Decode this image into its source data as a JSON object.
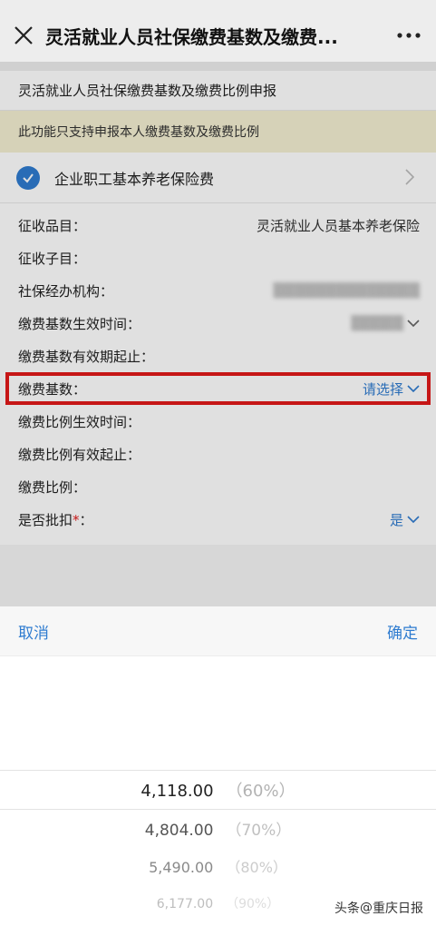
{
  "window": {
    "title": "灵活就业人员社保缴费基数及缴费..."
  },
  "page": {
    "header": "灵活就业人员社保缴费基数及缴费比例申报",
    "notice": "此功能只支持申报本人缴费基数及缴费比例",
    "insurance_item": "企业职工基本养老保险费",
    "fields": [
      {
        "label": "征收品目：",
        "value": "灵活就业人员基本养老保险"
      },
      {
        "label": "征收子目：",
        "value": ""
      },
      {
        "label": "社保经办机构：",
        "value": ""
      },
      {
        "label": "缴费基数生效时间：",
        "value": ""
      },
      {
        "label": "缴费基数有效期起止：",
        "value": ""
      },
      {
        "label": "缴费基数：",
        "value": "请选择"
      },
      {
        "label": "缴费比例生效时间：",
        "value": ""
      },
      {
        "label": "缴费比例有效起止：",
        "value": ""
      },
      {
        "label": "缴费比例：",
        "value": ""
      },
      {
        "label": "是否批扣",
        "required_mark": "*",
        "suffix": "：",
        "value": "是"
      }
    ]
  },
  "sheet": {
    "cancel": "取消",
    "confirm": "确定",
    "options": [
      {
        "amount": "4,118.00",
        "percent": "（60%）"
      },
      {
        "amount": "4,804.00",
        "percent": "（70%）"
      },
      {
        "amount": "5,490.00",
        "percent": "（80%）"
      },
      {
        "amount": "6,177.00",
        "percent": "（90%）"
      }
    ]
  },
  "watermark": {
    "prefix": "头条",
    "at": "@",
    "name": "重庆日报"
  },
  "colors": {
    "accent": "#2f7cd0",
    "highlight": "#e21a1a",
    "notice_bg": "#f4f0d2"
  }
}
